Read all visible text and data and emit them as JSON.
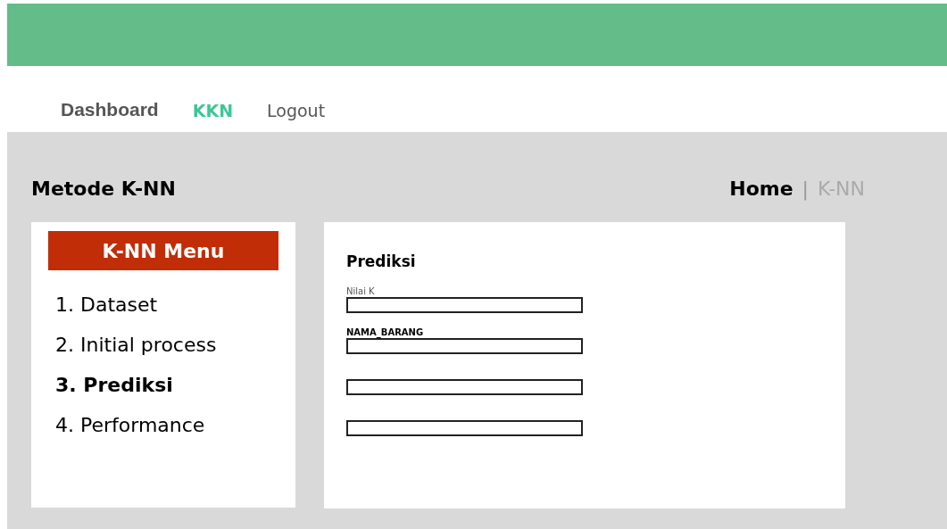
{
  "nav": {
    "brand": "Dashboard",
    "links": [
      {
        "label": "KKN",
        "selected": true
      },
      {
        "label": "Logout",
        "selected": false
      }
    ]
  },
  "page_title": "Metode K-NN",
  "breadcrumb": {
    "separator": "|",
    "items": [
      {
        "label": "Home",
        "current": false
      },
      {
        "label": "K-NN",
        "current": true
      }
    ]
  },
  "menu": {
    "title": "K-NN Menu",
    "items": [
      {
        "label": "1. Dataset",
        "selected": false
      },
      {
        "label": "2. Initial process",
        "selected": false
      },
      {
        "label": "3. Prediksi",
        "selected": true
      },
      {
        "label": "4. Performance",
        "selected": false
      }
    ]
  },
  "form": {
    "title": "Prediksi",
    "fields": [
      {
        "kind": "plain",
        "label": "Nilai K"
      },
      {
        "kind": "key",
        "label": "NAMA_BARANG"
      },
      {
        "kind": "unlabeled"
      },
      {
        "kind": "unlabeled"
      }
    ]
  }
}
